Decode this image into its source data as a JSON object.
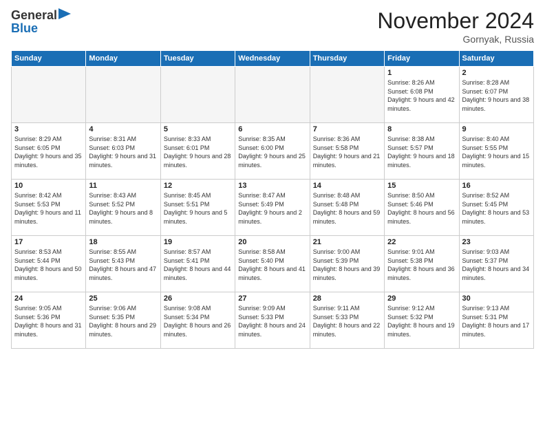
{
  "header": {
    "logo_line1": "General",
    "logo_line2": "Blue",
    "month": "November 2024",
    "location": "Gornyak, Russia"
  },
  "weekdays": [
    "Sunday",
    "Monday",
    "Tuesday",
    "Wednesday",
    "Thursday",
    "Friday",
    "Saturday"
  ],
  "weeks": [
    [
      {
        "day": "",
        "info": ""
      },
      {
        "day": "",
        "info": ""
      },
      {
        "day": "",
        "info": ""
      },
      {
        "day": "",
        "info": ""
      },
      {
        "day": "",
        "info": ""
      },
      {
        "day": "1",
        "info": "Sunrise: 8:26 AM\nSunset: 6:08 PM\nDaylight: 9 hours and 42 minutes."
      },
      {
        "day": "2",
        "info": "Sunrise: 8:28 AM\nSunset: 6:07 PM\nDaylight: 9 hours and 38 minutes."
      }
    ],
    [
      {
        "day": "3",
        "info": "Sunrise: 8:29 AM\nSunset: 6:05 PM\nDaylight: 9 hours and 35 minutes."
      },
      {
        "day": "4",
        "info": "Sunrise: 8:31 AM\nSunset: 6:03 PM\nDaylight: 9 hours and 31 minutes."
      },
      {
        "day": "5",
        "info": "Sunrise: 8:33 AM\nSunset: 6:01 PM\nDaylight: 9 hours and 28 minutes."
      },
      {
        "day": "6",
        "info": "Sunrise: 8:35 AM\nSunset: 6:00 PM\nDaylight: 9 hours and 25 minutes."
      },
      {
        "day": "7",
        "info": "Sunrise: 8:36 AM\nSunset: 5:58 PM\nDaylight: 9 hours and 21 minutes."
      },
      {
        "day": "8",
        "info": "Sunrise: 8:38 AM\nSunset: 5:57 PM\nDaylight: 9 hours and 18 minutes."
      },
      {
        "day": "9",
        "info": "Sunrise: 8:40 AM\nSunset: 5:55 PM\nDaylight: 9 hours and 15 minutes."
      }
    ],
    [
      {
        "day": "10",
        "info": "Sunrise: 8:42 AM\nSunset: 5:53 PM\nDaylight: 9 hours and 11 minutes."
      },
      {
        "day": "11",
        "info": "Sunrise: 8:43 AM\nSunset: 5:52 PM\nDaylight: 9 hours and 8 minutes."
      },
      {
        "day": "12",
        "info": "Sunrise: 8:45 AM\nSunset: 5:51 PM\nDaylight: 9 hours and 5 minutes."
      },
      {
        "day": "13",
        "info": "Sunrise: 8:47 AM\nSunset: 5:49 PM\nDaylight: 9 hours and 2 minutes."
      },
      {
        "day": "14",
        "info": "Sunrise: 8:48 AM\nSunset: 5:48 PM\nDaylight: 8 hours and 59 minutes."
      },
      {
        "day": "15",
        "info": "Sunrise: 8:50 AM\nSunset: 5:46 PM\nDaylight: 8 hours and 56 minutes."
      },
      {
        "day": "16",
        "info": "Sunrise: 8:52 AM\nSunset: 5:45 PM\nDaylight: 8 hours and 53 minutes."
      }
    ],
    [
      {
        "day": "17",
        "info": "Sunrise: 8:53 AM\nSunset: 5:44 PM\nDaylight: 8 hours and 50 minutes."
      },
      {
        "day": "18",
        "info": "Sunrise: 8:55 AM\nSunset: 5:43 PM\nDaylight: 8 hours and 47 minutes."
      },
      {
        "day": "19",
        "info": "Sunrise: 8:57 AM\nSunset: 5:41 PM\nDaylight: 8 hours and 44 minutes."
      },
      {
        "day": "20",
        "info": "Sunrise: 8:58 AM\nSunset: 5:40 PM\nDaylight: 8 hours and 41 minutes."
      },
      {
        "day": "21",
        "info": "Sunrise: 9:00 AM\nSunset: 5:39 PM\nDaylight: 8 hours and 39 minutes."
      },
      {
        "day": "22",
        "info": "Sunrise: 9:01 AM\nSunset: 5:38 PM\nDaylight: 8 hours and 36 minutes."
      },
      {
        "day": "23",
        "info": "Sunrise: 9:03 AM\nSunset: 5:37 PM\nDaylight: 8 hours and 34 minutes."
      }
    ],
    [
      {
        "day": "24",
        "info": "Sunrise: 9:05 AM\nSunset: 5:36 PM\nDaylight: 8 hours and 31 minutes."
      },
      {
        "day": "25",
        "info": "Sunrise: 9:06 AM\nSunset: 5:35 PM\nDaylight: 8 hours and 29 minutes."
      },
      {
        "day": "26",
        "info": "Sunrise: 9:08 AM\nSunset: 5:34 PM\nDaylight: 8 hours and 26 minutes."
      },
      {
        "day": "27",
        "info": "Sunrise: 9:09 AM\nSunset: 5:33 PM\nDaylight: 8 hours and 24 minutes."
      },
      {
        "day": "28",
        "info": "Sunrise: 9:11 AM\nSunset: 5:33 PM\nDaylight: 8 hours and 22 minutes."
      },
      {
        "day": "29",
        "info": "Sunrise: 9:12 AM\nSunset: 5:32 PM\nDaylight: 8 hours and 19 minutes."
      },
      {
        "day": "30",
        "info": "Sunrise: 9:13 AM\nSunset: 5:31 PM\nDaylight: 8 hours and 17 minutes."
      }
    ]
  ]
}
